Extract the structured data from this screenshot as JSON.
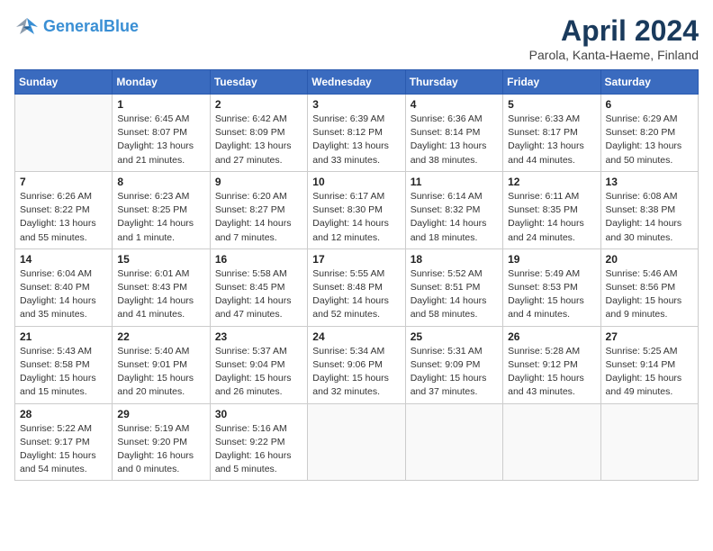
{
  "header": {
    "logo_line1": "General",
    "logo_line2": "Blue",
    "month_title": "April 2024",
    "location": "Parola, Kanta-Haeme, Finland"
  },
  "weekdays": [
    "Sunday",
    "Monday",
    "Tuesday",
    "Wednesday",
    "Thursday",
    "Friday",
    "Saturday"
  ],
  "weeks": [
    [
      {
        "day": "",
        "info": ""
      },
      {
        "day": "1",
        "info": "Sunrise: 6:45 AM\nSunset: 8:07 PM\nDaylight: 13 hours\nand 21 minutes."
      },
      {
        "day": "2",
        "info": "Sunrise: 6:42 AM\nSunset: 8:09 PM\nDaylight: 13 hours\nand 27 minutes."
      },
      {
        "day": "3",
        "info": "Sunrise: 6:39 AM\nSunset: 8:12 PM\nDaylight: 13 hours\nand 33 minutes."
      },
      {
        "day": "4",
        "info": "Sunrise: 6:36 AM\nSunset: 8:14 PM\nDaylight: 13 hours\nand 38 minutes."
      },
      {
        "day": "5",
        "info": "Sunrise: 6:33 AM\nSunset: 8:17 PM\nDaylight: 13 hours\nand 44 minutes."
      },
      {
        "day": "6",
        "info": "Sunrise: 6:29 AM\nSunset: 8:20 PM\nDaylight: 13 hours\nand 50 minutes."
      }
    ],
    [
      {
        "day": "7",
        "info": "Sunrise: 6:26 AM\nSunset: 8:22 PM\nDaylight: 13 hours\nand 55 minutes."
      },
      {
        "day": "8",
        "info": "Sunrise: 6:23 AM\nSunset: 8:25 PM\nDaylight: 14 hours\nand 1 minute."
      },
      {
        "day": "9",
        "info": "Sunrise: 6:20 AM\nSunset: 8:27 PM\nDaylight: 14 hours\nand 7 minutes."
      },
      {
        "day": "10",
        "info": "Sunrise: 6:17 AM\nSunset: 8:30 PM\nDaylight: 14 hours\nand 12 minutes."
      },
      {
        "day": "11",
        "info": "Sunrise: 6:14 AM\nSunset: 8:32 PM\nDaylight: 14 hours\nand 18 minutes."
      },
      {
        "day": "12",
        "info": "Sunrise: 6:11 AM\nSunset: 8:35 PM\nDaylight: 14 hours\nand 24 minutes."
      },
      {
        "day": "13",
        "info": "Sunrise: 6:08 AM\nSunset: 8:38 PM\nDaylight: 14 hours\nand 30 minutes."
      }
    ],
    [
      {
        "day": "14",
        "info": "Sunrise: 6:04 AM\nSunset: 8:40 PM\nDaylight: 14 hours\nand 35 minutes."
      },
      {
        "day": "15",
        "info": "Sunrise: 6:01 AM\nSunset: 8:43 PM\nDaylight: 14 hours\nand 41 minutes."
      },
      {
        "day": "16",
        "info": "Sunrise: 5:58 AM\nSunset: 8:45 PM\nDaylight: 14 hours\nand 47 minutes."
      },
      {
        "day": "17",
        "info": "Sunrise: 5:55 AM\nSunset: 8:48 PM\nDaylight: 14 hours\nand 52 minutes."
      },
      {
        "day": "18",
        "info": "Sunrise: 5:52 AM\nSunset: 8:51 PM\nDaylight: 14 hours\nand 58 minutes."
      },
      {
        "day": "19",
        "info": "Sunrise: 5:49 AM\nSunset: 8:53 PM\nDaylight: 15 hours\nand 4 minutes."
      },
      {
        "day": "20",
        "info": "Sunrise: 5:46 AM\nSunset: 8:56 PM\nDaylight: 15 hours\nand 9 minutes."
      }
    ],
    [
      {
        "day": "21",
        "info": "Sunrise: 5:43 AM\nSunset: 8:58 PM\nDaylight: 15 hours\nand 15 minutes."
      },
      {
        "day": "22",
        "info": "Sunrise: 5:40 AM\nSunset: 9:01 PM\nDaylight: 15 hours\nand 20 minutes."
      },
      {
        "day": "23",
        "info": "Sunrise: 5:37 AM\nSunset: 9:04 PM\nDaylight: 15 hours\nand 26 minutes."
      },
      {
        "day": "24",
        "info": "Sunrise: 5:34 AM\nSunset: 9:06 PM\nDaylight: 15 hours\nand 32 minutes."
      },
      {
        "day": "25",
        "info": "Sunrise: 5:31 AM\nSunset: 9:09 PM\nDaylight: 15 hours\nand 37 minutes."
      },
      {
        "day": "26",
        "info": "Sunrise: 5:28 AM\nSunset: 9:12 PM\nDaylight: 15 hours\nand 43 minutes."
      },
      {
        "day": "27",
        "info": "Sunrise: 5:25 AM\nSunset: 9:14 PM\nDaylight: 15 hours\nand 49 minutes."
      }
    ],
    [
      {
        "day": "28",
        "info": "Sunrise: 5:22 AM\nSunset: 9:17 PM\nDaylight: 15 hours\nand 54 minutes."
      },
      {
        "day": "29",
        "info": "Sunrise: 5:19 AM\nSunset: 9:20 PM\nDaylight: 16 hours\nand 0 minutes."
      },
      {
        "day": "30",
        "info": "Sunrise: 5:16 AM\nSunset: 9:22 PM\nDaylight: 16 hours\nand 5 minutes."
      },
      {
        "day": "",
        "info": ""
      },
      {
        "day": "",
        "info": ""
      },
      {
        "day": "",
        "info": ""
      },
      {
        "day": "",
        "info": ""
      }
    ]
  ]
}
